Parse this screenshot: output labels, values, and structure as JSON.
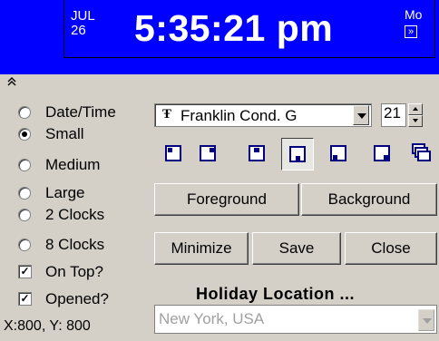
{
  "clock": {
    "month": "JUL",
    "day": "26",
    "time": "5:35:21 pm",
    "weekday": "Mo"
  },
  "display_modes": [
    {
      "label": "Date/Time",
      "selected": false
    },
    {
      "label": "Small",
      "selected": true
    },
    {
      "label": "Medium",
      "selected": false
    },
    {
      "label": "Large",
      "selected": false
    },
    {
      "label": "2 Clocks",
      "selected": false
    },
    {
      "label": "8 Clocks",
      "selected": false
    }
  ],
  "options": {
    "on_top_label": "On Top?",
    "on_top_checked": true,
    "opened_label": "Opened?",
    "opened_checked": true
  },
  "coordinates": "X:800, Y: 800",
  "font": {
    "icon": "truetype-font-icon",
    "name": "Franklin Cond. G",
    "size": "21"
  },
  "position_buttons": [
    {
      "name": "top-left-position-icon"
    },
    {
      "name": "top-center-position-icon"
    },
    {
      "name": "top-right-position-icon"
    },
    {
      "name": "bottom-left-position-icon",
      "pressed": true
    },
    {
      "name": "bottom-center-position-icon"
    },
    {
      "name": "bottom-right-position-icon"
    },
    {
      "name": "cascade-windows-icon"
    }
  ],
  "buttons": {
    "foreground": "Foreground",
    "background": "Background",
    "minimize": "Minimize",
    "save": "Save",
    "close": "Close"
  },
  "holiday": {
    "label": "Holiday Location ...",
    "value": "New York, USA"
  },
  "colors": {
    "clock_background": "#0000ff",
    "clock_text": "#ffffff",
    "window": "#d4d0c8",
    "icon_accent": "#000080"
  }
}
